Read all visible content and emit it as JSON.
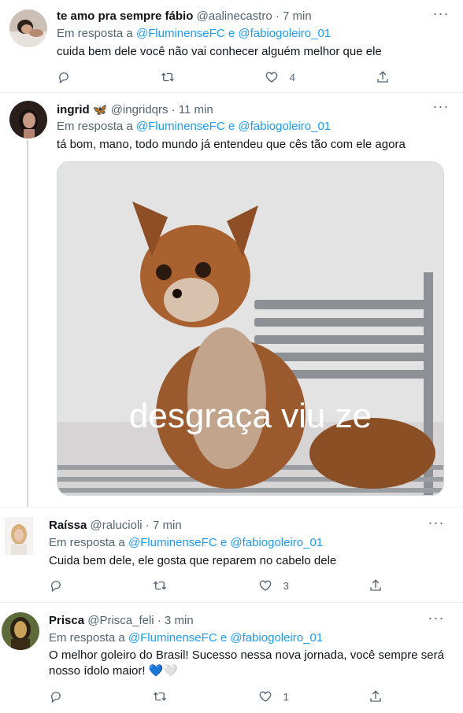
{
  "tweets": [
    {
      "display_name": "te amo pra sempre fábio",
      "handle": "@aalinecastro",
      "time": "7 min",
      "reply_prefix": "Em resposta a",
      "reply_to_1": "@FluminenseFC",
      "reply_joiner": "e",
      "reply_to_2": "@fabiogoleiro_01",
      "text": "cuida bem dele você não vai conhecer alguém melhor que ele",
      "replies": "",
      "retweets": "",
      "likes": "4"
    },
    {
      "display_name": "ingrid",
      "name_emoji": "🦋",
      "handle": "@ingridqrs",
      "time": "11 min",
      "reply_prefix": "Em resposta a",
      "reply_to_1": "@FluminenseFC",
      "reply_joiner": "e",
      "reply_to_2": "@fabiogoleiro_01",
      "text": "tá bom, mano, todo mundo já entendeu que cês tão com ele agora",
      "media_caption": "desgraça viu ze"
    },
    {
      "display_name": "Raíssa",
      "handle": "@ralucioli",
      "time": "7 min",
      "reply_prefix": "Em resposta a",
      "reply_to_1": "@FluminenseFC",
      "reply_joiner": "e",
      "reply_to_2": "@fabiogoleiro_01",
      "text": "Cuida bem dele, ele gosta que reparem no cabelo dele",
      "replies": "",
      "retweets": "",
      "likes": "3"
    },
    {
      "display_name": "Prisca",
      "handle": "@Prisca_feli",
      "time": "3 min",
      "reply_prefix": "Em resposta a",
      "reply_to_1": "@FluminenseFC",
      "reply_joiner": "e",
      "reply_to_2": "@fabiogoleiro_01",
      "text_line1": "O melhor goleiro do Brasil! Sucesso nessa nova jornada, você sempre será",
      "text_line2": "nosso ídolo maior!",
      "text_emoji": "💙🤍",
      "replies": "",
      "retweets": "",
      "likes": "1"
    }
  ],
  "separator": "·",
  "more_glyph": "···",
  "icons": {
    "reply": "reply-icon",
    "retweet": "retweet-icon",
    "like": "like-icon",
    "share": "share-icon",
    "more": "more-icon"
  },
  "colors": {
    "link": "#1d9bf0",
    "muted": "#536471",
    "text": "#0f1419",
    "border": "#eff3f4",
    "heart": "#4aa0ec"
  }
}
